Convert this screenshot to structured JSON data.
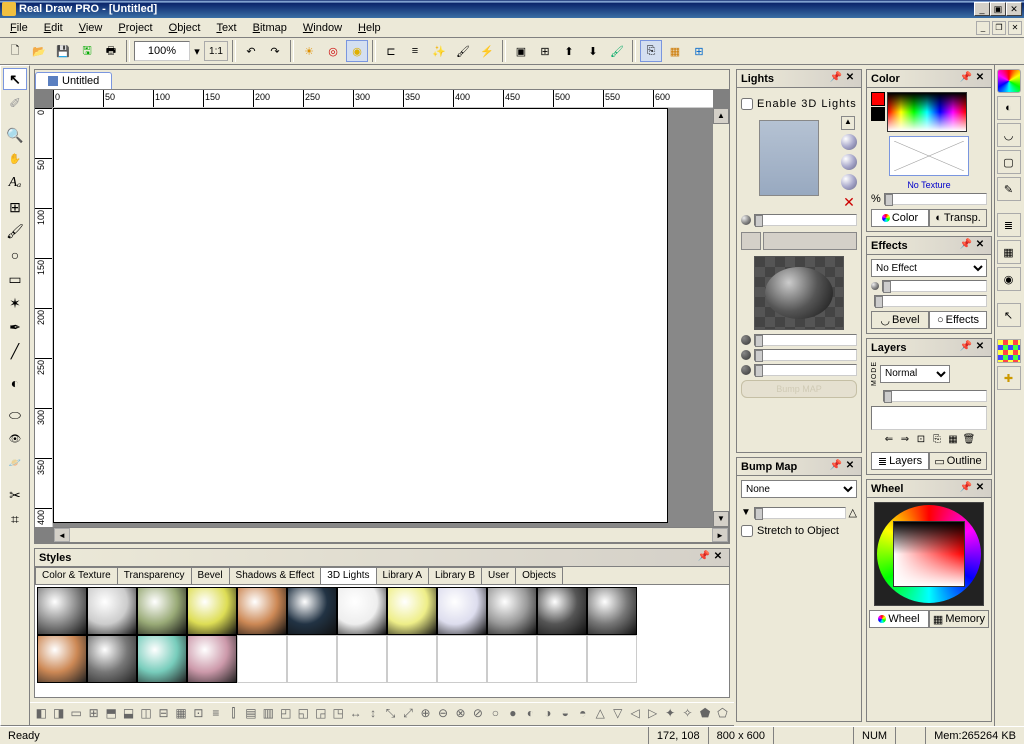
{
  "title": "Real Draw PRO - [Untitled]",
  "menus": [
    "File",
    "Edit",
    "View",
    "Project",
    "Object",
    "Text",
    "Bitmap",
    "Window",
    "Help"
  ],
  "zoom": "100%",
  "zoom11": "1:1",
  "doc_tab": "Untitled",
  "ruler_ticks": [
    "0",
    "50",
    "100",
    "150",
    "200",
    "250",
    "300",
    "350",
    "400",
    "450",
    "500",
    "550",
    "600"
  ],
  "ruler_v_ticks": [
    "0",
    "50",
    "100",
    "150",
    "200",
    "250",
    "300",
    "350",
    "400"
  ],
  "panels": {
    "lights": {
      "title": "Lights",
      "enable": "Enable 3D Lights",
      "bump_btn": "Bump MAP"
    },
    "color": {
      "title": "Color",
      "no_texture": "No Texture",
      "pct": "%",
      "tab_color": "Color",
      "tab_transp": "Transp."
    },
    "effects": {
      "title": "Effects",
      "sel": "No Effect",
      "tab_bevel": "Bevel",
      "tab_effects": "Effects"
    },
    "layers": {
      "title": "Layers",
      "mode": "Normal",
      "tab_layers": "Layers",
      "tab_outline": "Outline",
      "mode_lbl": "MODE"
    },
    "wheel": {
      "title": "Wheel",
      "tab_wheel": "Wheel",
      "tab_memory": "Memory"
    },
    "bump": {
      "title": "Bump Map",
      "sel": "None",
      "stretch": "Stretch to Object"
    },
    "styles": {
      "title": "Styles",
      "tabs": [
        "Color & Texture",
        "Transparency",
        "Bevel",
        "Shadows & Effect",
        "3D Lights",
        "Library A",
        "Library B",
        "User",
        "Objects"
      ],
      "active_tab": 4
    }
  },
  "status": {
    "ready": "Ready",
    "coords": "172, 108",
    "dims": "800 x 600",
    "num": "NUM",
    "mem": "Mem:265264 KB"
  }
}
